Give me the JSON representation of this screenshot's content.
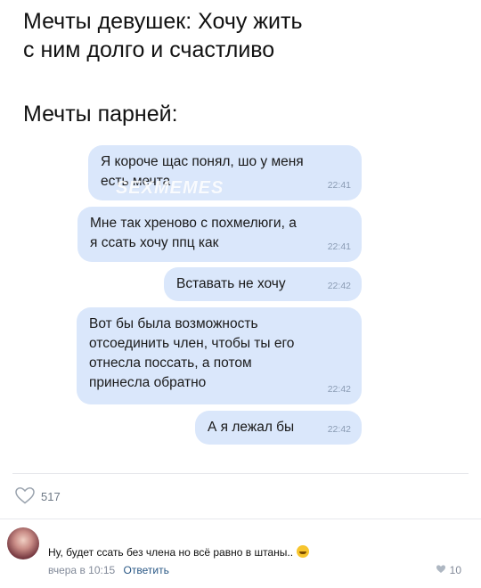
{
  "post": {
    "line1": "Мечты девушек: Хочу жить",
    "line2": "с ним долго и счастливо",
    "line3": "Мечты парней:"
  },
  "chat": {
    "watermark": "SEXMEMES",
    "messages": [
      {
        "text": "Я короче щас понял, шо у меня\nесть мечта",
        "time": "22:41"
      },
      {
        "text": "Мне так хреново с похмелюги, а\nя ссать хочу ппц как",
        "time": "22:41"
      },
      {
        "text": "Вставать не хочу",
        "time": "22:42"
      },
      {
        "text": "Вот бы была возможность\nотсоединить член, чтобы ты его\nотнесла поссать, а потом\nпринесла обратно",
        "time": "22:42"
      },
      {
        "text": "А я лежал бы",
        "time": "22:42"
      }
    ]
  },
  "likes": {
    "count": "517",
    "icon": "heart-outline-icon"
  },
  "comment": {
    "text": "Ну, будет ссать без члена но всё равно в штаны..",
    "emoji": "laughing-face-emoji",
    "time": "вчера в 10:15",
    "reply_label": "Ответить",
    "likes": "10"
  },
  "colors": {
    "bubble": "#dae7fb",
    "link": "#2a5885",
    "muted": "#828a99"
  }
}
